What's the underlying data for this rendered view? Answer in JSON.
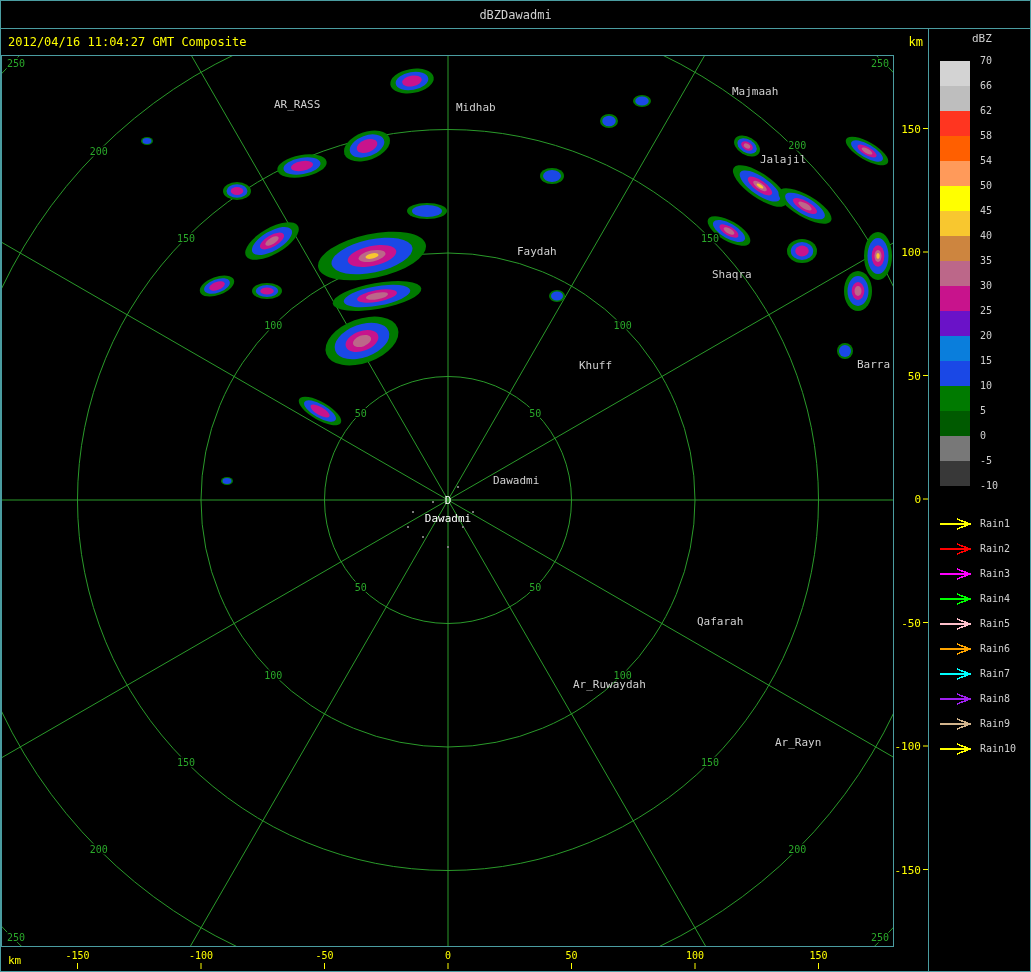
{
  "window": {
    "title": "dBZDawadmi"
  },
  "header": {
    "timestamp": "2012/04/16 11:04:27 GMT Composite",
    "unit": "km"
  },
  "rings": [
    {
      "labels": [
        "50",
        "50",
        "50",
        "50"
      ]
    },
    {
      "labels": [
        "100",
        "100",
        "100",
        "100"
      ]
    },
    {
      "labels": [
        "150",
        "150",
        "150",
        "150"
      ]
    },
    {
      "labels": [
        "200",
        "200",
        "200",
        "200"
      ]
    },
    {
      "labels": [
        "250",
        "250",
        "250",
        "250"
      ]
    }
  ],
  "station": {
    "marker": "D",
    "name": "Dawadmi"
  },
  "cities": [
    "AR_RASS",
    "Midhab",
    "Majmaah",
    "Jalajil",
    "Faydah",
    "Shaqra",
    "Khuff",
    "Barra",
    "Dawadmi",
    "Qafarah",
    "Ar_Ruwaydah",
    "Ar_Rayn"
  ],
  "y_axis": {
    "ticks": [
      "150",
      "100",
      "50",
      "0",
      "-50",
      "-100",
      "-150"
    ]
  },
  "x_axis": {
    "unit": "km",
    "ticks": [
      "-150",
      "-100",
      "-50",
      "0",
      "50",
      "100",
      "150"
    ]
  },
  "legend": {
    "title": "dBZ",
    "swatches": [
      {
        "color": "#d3d3d3"
      },
      {
        "color": "#bebebe"
      },
      {
        "color": "#ff3520"
      },
      {
        "color": "#ff5f00"
      },
      {
        "color": "#ff9a5a"
      },
      {
        "color": "#ffff00"
      },
      {
        "color": "#f8c72f"
      },
      {
        "color": "#cd853f"
      },
      {
        "color": "#bc6789"
      },
      {
        "color": "#c8138c"
      },
      {
        "color": "#6a12c8"
      },
      {
        "color": "#0a7edc"
      },
      {
        "color": "#1a48e6"
      },
      {
        "color": "#007a00"
      },
      {
        "color": "#005a00"
      },
      {
        "color": "#787878"
      },
      {
        "color": "#383838"
      }
    ],
    "ticks": [
      "70",
      "66",
      "62",
      "58",
      "54",
      "50",
      "45",
      "40",
      "35",
      "30",
      "25",
      "20",
      "15",
      "10",
      "5",
      "0",
      "-5",
      "-10"
    ]
  },
  "tracks": [
    {
      "label": "Rain1",
      "color": "#ffff00"
    },
    {
      "label": "Rain2",
      "color": "#ff0000"
    },
    {
      "label": "Rain3",
      "color": "#ff00ff"
    },
    {
      "label": "Rain4",
      "color": "#00ff00"
    },
    {
      "label": "Rain5",
      "color": "#ffc0cb"
    },
    {
      "label": "Rain6",
      "color": "#ffa500"
    },
    {
      "label": "Rain7",
      "color": "#00ffff"
    },
    {
      "label": "Rain8",
      "color": "#a020f0"
    },
    {
      "label": "Rain9",
      "color": "#d2b48c"
    },
    {
      "label": "Rain10",
      "color": "#ffff00"
    }
  ]
}
